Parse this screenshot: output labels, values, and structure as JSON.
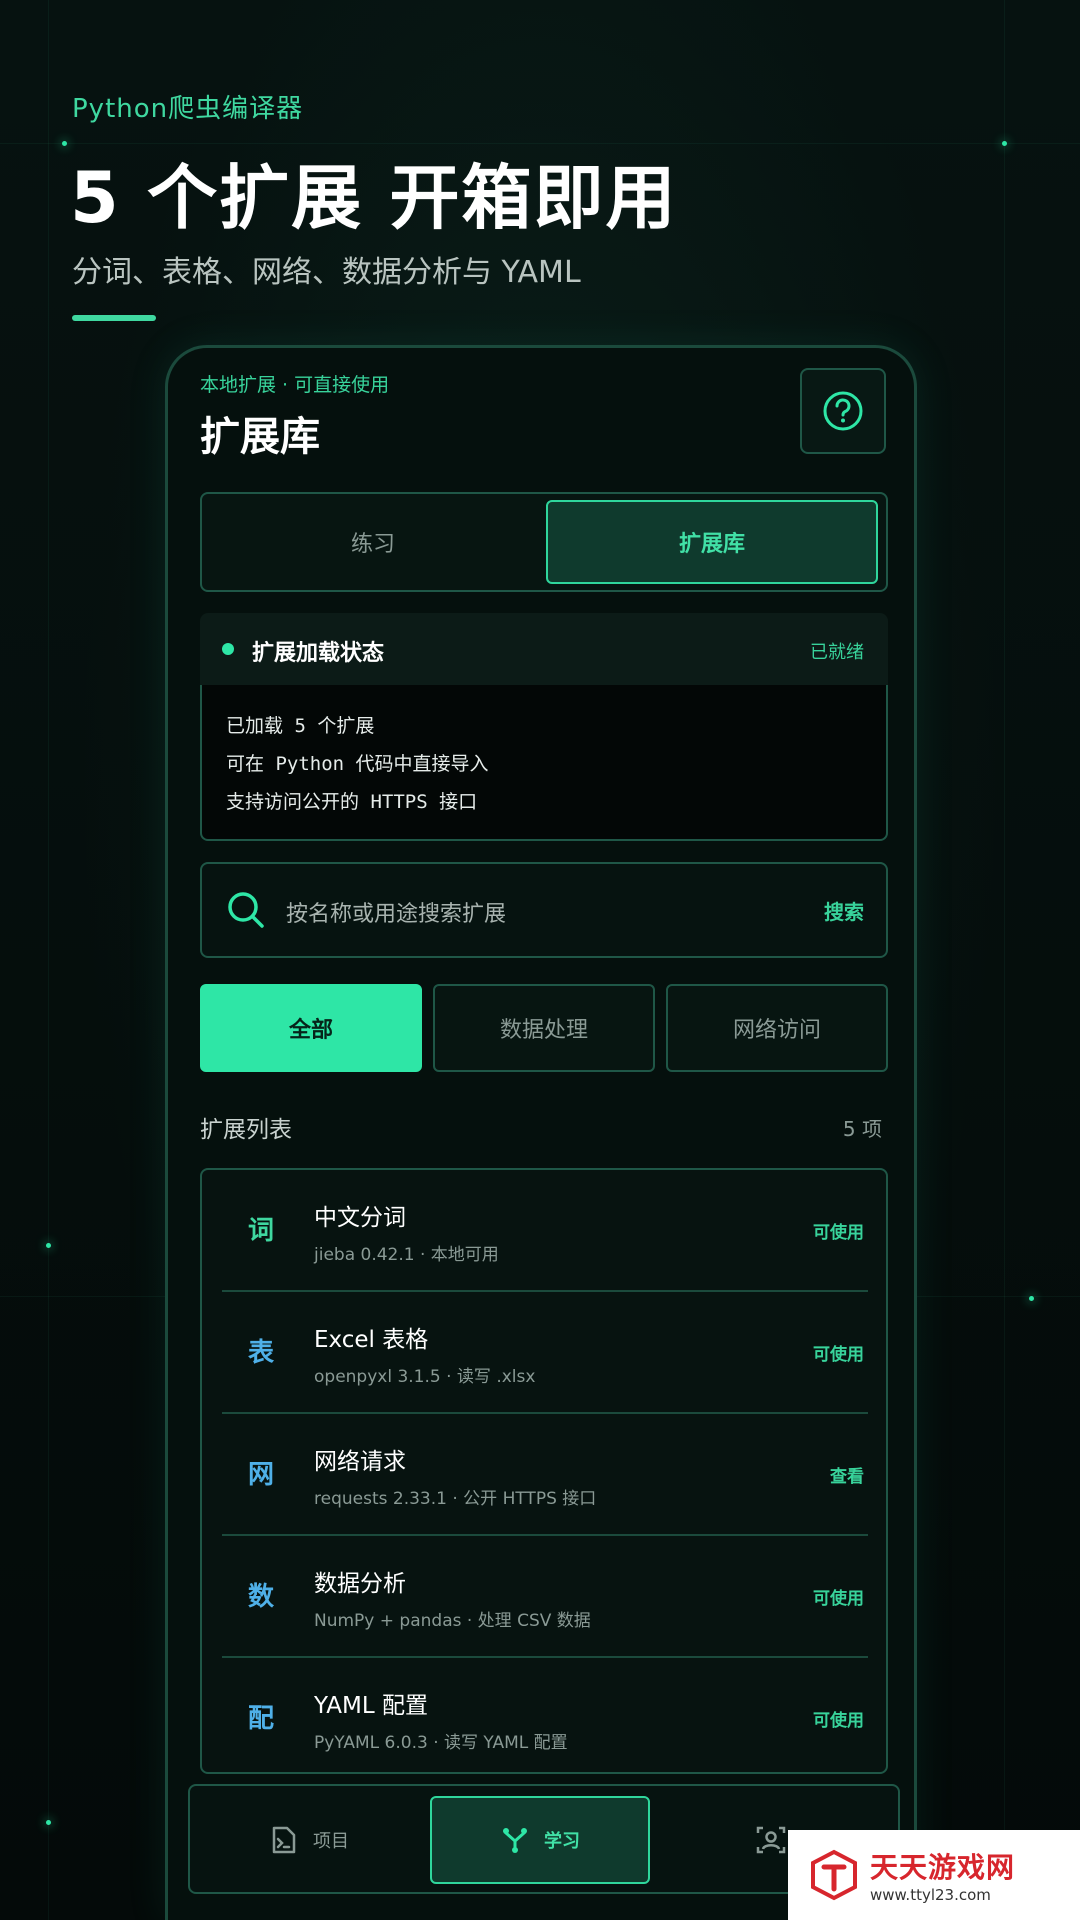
{
  "promo": {
    "app_name": "Python爬虫编译器",
    "headline": "5 个扩展 开箱即用",
    "description": "分词、表格、网络、数据分析与 YAML"
  },
  "header": {
    "subtitle": "本地扩展 · 可直接使用",
    "title": "扩展库",
    "help_icon": "help-circle-icon"
  },
  "tabs": [
    {
      "label": "练习",
      "active": false
    },
    {
      "label": "扩展库",
      "active": true
    }
  ],
  "status": {
    "title": "扩展加载状态",
    "badge": "已就绪",
    "lines": [
      "已加载 5 个扩展",
      "可在 Python 代码中直接导入",
      "支持访问公开的 HTTPS 接口"
    ]
  },
  "search": {
    "placeholder": "按名称或用途搜索扩展",
    "button": "搜索"
  },
  "filters": [
    {
      "label": "全部",
      "active": true
    },
    {
      "label": "数据处理",
      "active": false
    },
    {
      "label": "网络访问",
      "active": false
    }
  ],
  "list": {
    "title": "扩展列表",
    "count": "5 项",
    "items": [
      {
        "glyph": "词",
        "glyph_color": "#3fd8a0",
        "name": "中文分词",
        "meta": "jieba 0.42.1 · 本地可用",
        "status": "可使用"
      },
      {
        "glyph": "表",
        "glyph_color": "#4fb0e8",
        "name": "Excel 表格",
        "meta": "openpyxl 3.1.5 · 读写 .xlsx",
        "status": "可使用"
      },
      {
        "glyph": "网",
        "glyph_color": "#4fb0e8",
        "name": "网络请求",
        "meta": "requests 2.33.1 · 公开 HTTPS 接口",
        "status": "查看"
      },
      {
        "glyph": "数",
        "glyph_color": "#4fb0e8",
        "name": "数据分析",
        "meta": "NumPy + pandas · 处理 CSV 数据",
        "status": "可使用"
      },
      {
        "glyph": "配",
        "glyph_color": "#4fb0e8",
        "name": "YAML 配置",
        "meta": "PyYAML 6.0.3 · 读写 YAML 配置",
        "status": "可使用"
      }
    ]
  },
  "nav": {
    "items": [
      {
        "label": "项目",
        "icon": "terminal-file-icon",
        "active": false
      },
      {
        "label": "学习",
        "icon": "fork-icon",
        "active": true
      },
      {
        "label": "",
        "icon": "user-frame-icon",
        "active": false
      }
    ]
  },
  "watermark": {
    "brand": "天天游戏网",
    "url": "www.ttyl23.com"
  },
  "colors": {
    "accent": "#2ee6a6",
    "background": "#040a09",
    "border": "#1f5747"
  }
}
